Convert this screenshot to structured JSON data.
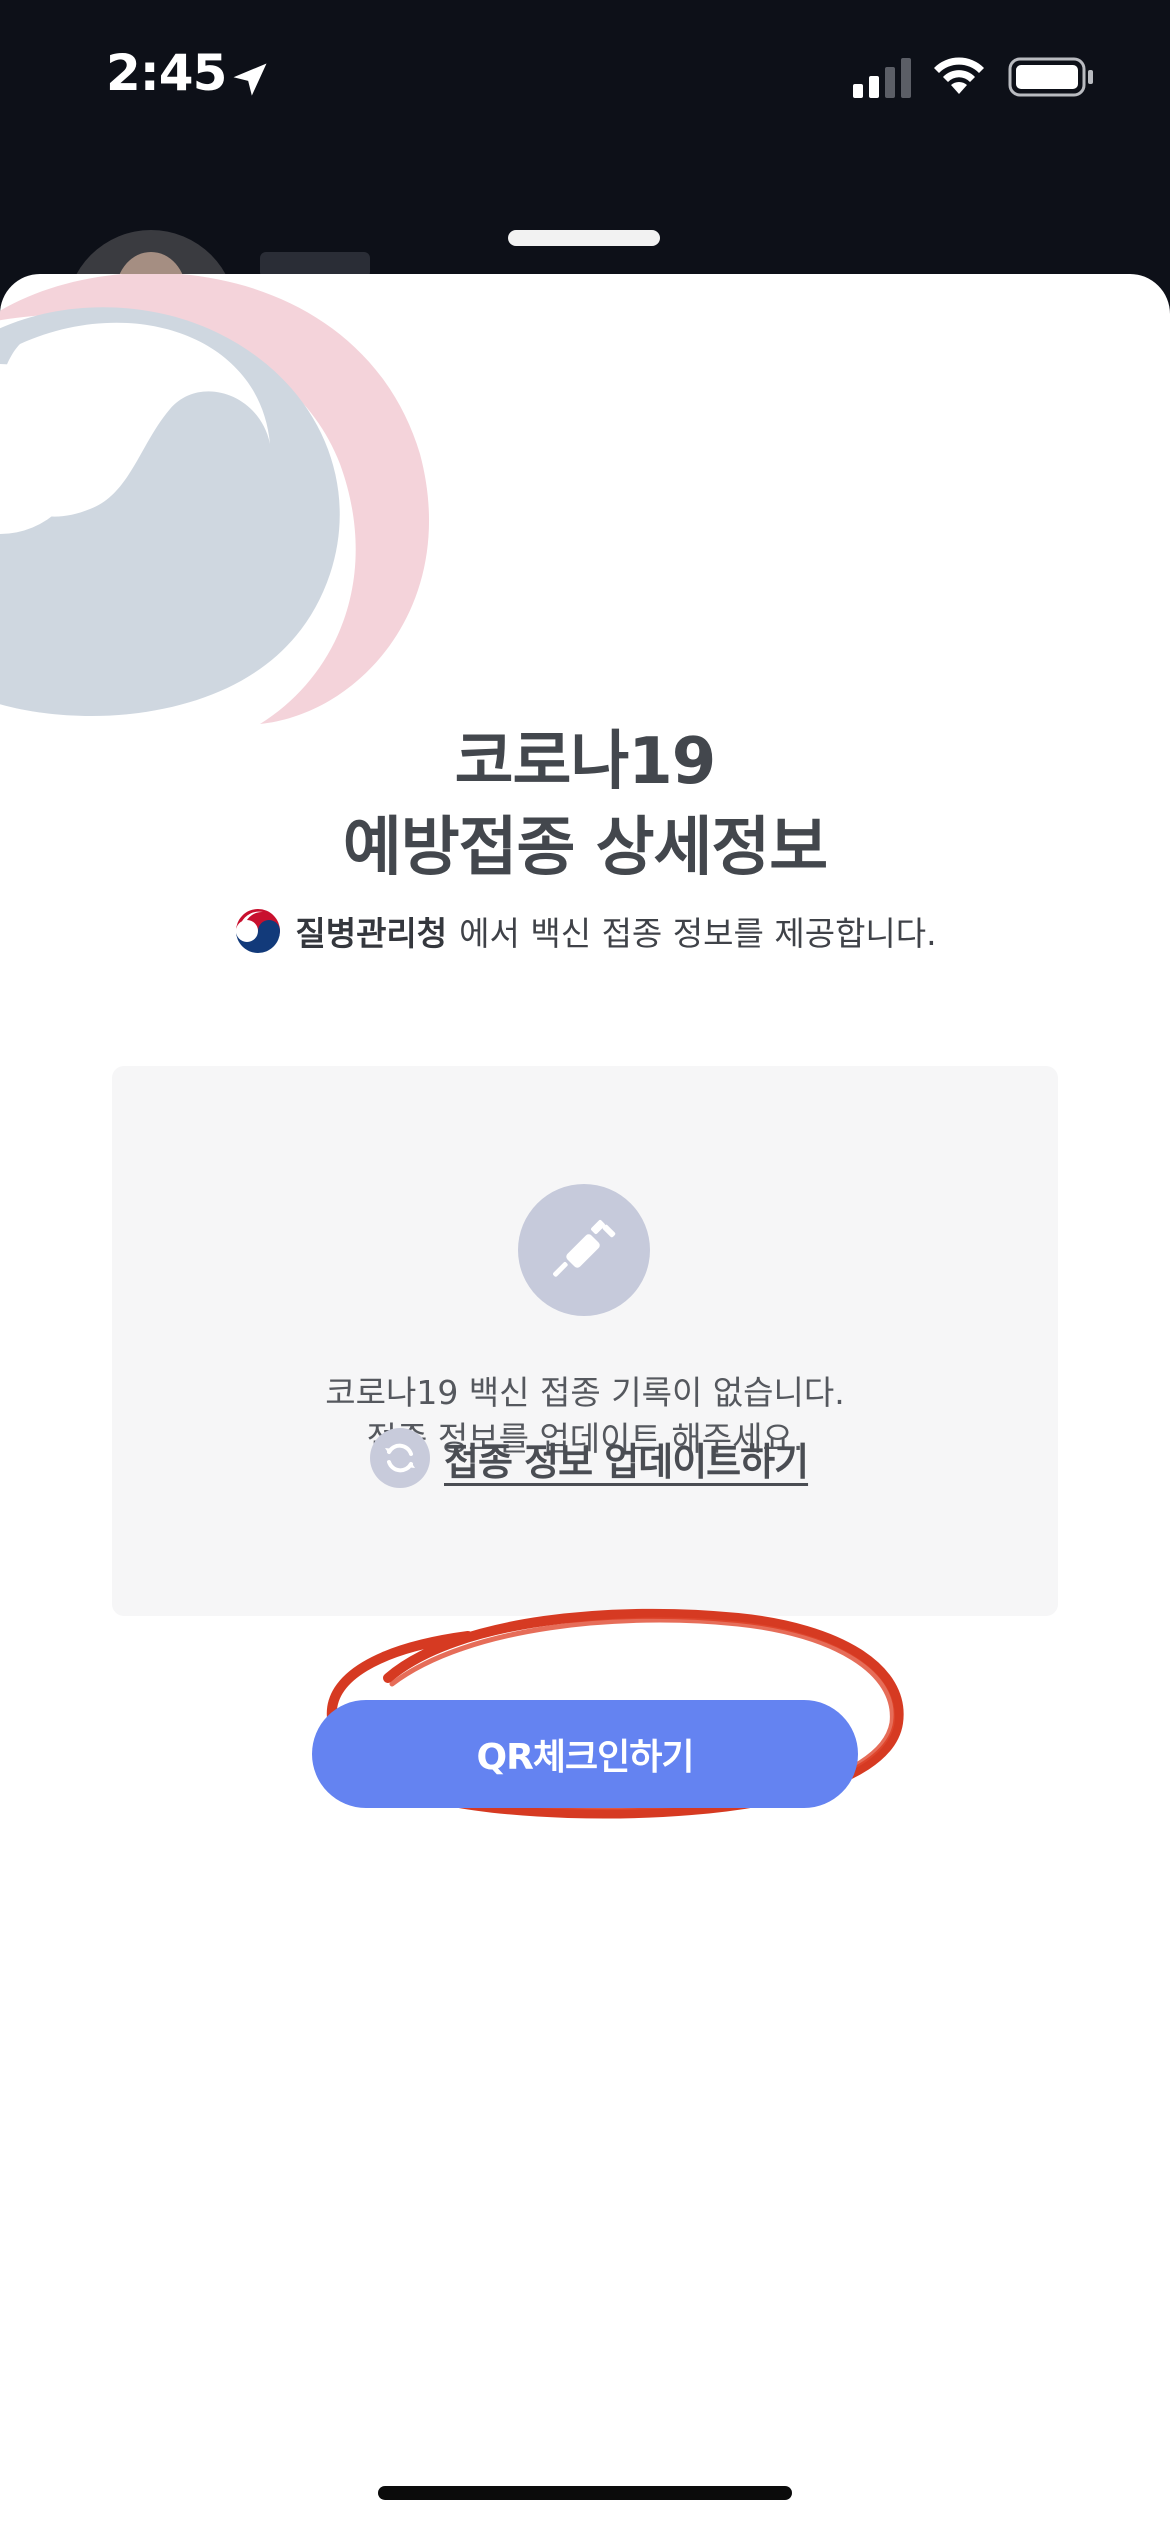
{
  "status_bar": {
    "time": "2:45",
    "icons": [
      "location-arrow-icon",
      "cellular-signal-icon",
      "wifi-icon",
      "battery-icon"
    ]
  },
  "sheet": {
    "title_line1": "코로나19",
    "title_line2": "예방접종 상세정보",
    "provider": {
      "name": "질병관리청",
      "suffix": "에서 백신 접종 정보를 제공합니다.",
      "logo_icon": "korea-government-emblem-icon"
    },
    "info_card": {
      "icon": "syringe-icon",
      "message_line1": "코로나19 백신 접종 기록이 없습니다.",
      "message_line2": "접종 정보를 업데이트 해주세요."
    },
    "update_link": {
      "icon": "refresh-icon",
      "label": "접종 정보 업데이트하기"
    },
    "qr_button": {
      "label": "QR체크인하기"
    }
  },
  "colors": {
    "status_bar_bg": "#0d1018",
    "sheet_bg": "#ffffff",
    "card_bg": "#f6f6f7",
    "primary_button": "#6483f1",
    "annotation_red": "#d63a22",
    "title_text": "#43474d"
  }
}
